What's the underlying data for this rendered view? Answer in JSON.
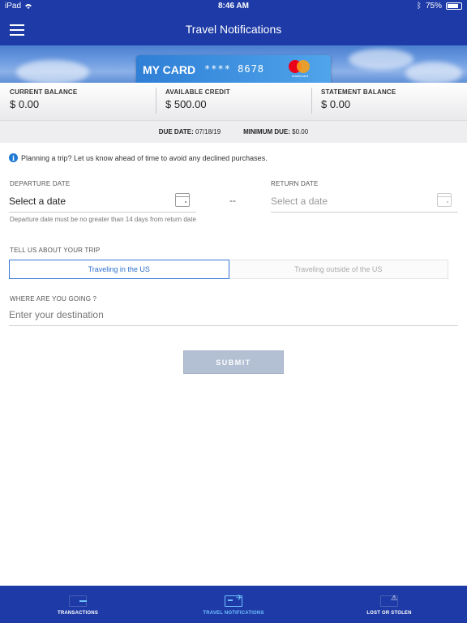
{
  "status_bar": {
    "device": "iPad",
    "time": "8:46 AM",
    "battery": "75%"
  },
  "header": {
    "title": "Travel Notifications"
  },
  "card": {
    "name": "MY CARD",
    "number": "**** 8678",
    "brand": "mastercard"
  },
  "balances": [
    {
      "label": "CURRENT BALANCE",
      "value": "$ 0.00"
    },
    {
      "label": "AVAILABLE CREDIT",
      "value": "$ 500.00"
    },
    {
      "label": "STATEMENT BALANCE",
      "value": "$ 0.00"
    }
  ],
  "due": {
    "due_date_label": "DUE DATE:",
    "due_date_value": "07/18/19",
    "minimum_due_label": "MINIMUM DUE:",
    "minimum_due_value": "$0.00"
  },
  "form": {
    "info_text": "Planning a trip? Let us know ahead of time to avoid any declined purchases.",
    "departure_label": "DEPARTURE DATE",
    "departure_value": "Select a date",
    "separator": "--",
    "return_label": "RETURN DATE",
    "return_placeholder": "Select a date",
    "departure_hint": "Departure date must be no greater than 14 days from return date",
    "trip_label": "TELL US ABOUT YOUR TRIP",
    "trip_options": [
      "Traveling in the US",
      "Traveling outside of the US"
    ],
    "trip_selected": "Traveling in the US",
    "destination_label": "WHERE ARE YOU GOING ?",
    "destination_placeholder": "Enter your destination",
    "submit_label": "SUBMIT"
  },
  "tabs": [
    {
      "label": "TRANSACTIONS",
      "active": false
    },
    {
      "label": "TRAVEL NOTIFICATIONS",
      "active": true
    },
    {
      "label": "LOST OR STOLEN",
      "active": false
    }
  ],
  "colors": {
    "brand": "#1d3aa6",
    "accent": "#3a79d4",
    "tab_active": "#6fc0ff"
  }
}
